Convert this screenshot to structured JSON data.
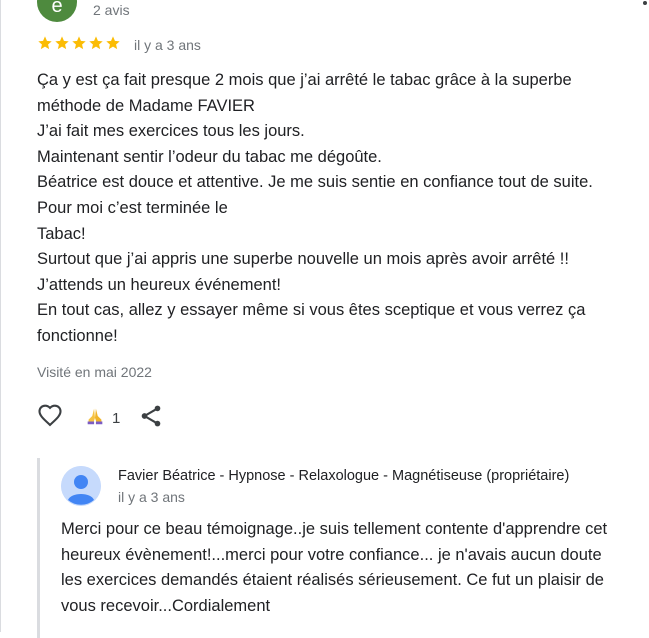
{
  "review": {
    "avatar_letter": "e",
    "avatar_color": "#4e8a3e",
    "review_count": "2 avis",
    "rating": 5,
    "star_color": "#fbbc04",
    "time_ago": "il y a 3 ans",
    "text_lines": [
      "Ça y est ça fait presque 2 mois que j’ai arrêté le tabac grâce à la superbe",
      "méthode de Madame FAVIER",
      "J’ai fait mes exercices tous les jours.",
      "Maintenant sentir l’odeur du tabac me dégoûte.",
      "Béatrice est douce et attentive. Je me suis sentie en confiance tout de suite.",
      "Pour moi c’est terminée le",
      "Tabac!",
      "Surtout que j’ai appris une superbe nouvelle un mois après avoir arrêté !!",
      "J’attends un heureux événement!",
      "En tout cas, allez y essayer même si vous êtes sceptique et vous verrez ça",
      "fonctionne!"
    ],
    "visited": "Visité en mai 2022",
    "reaction_count": "1",
    "like_icon": "heart-outline-icon",
    "reaction_icon": "praying-hands-icon",
    "share_icon": "share-icon"
  },
  "owner_reply": {
    "name": "Favier Béatrice - Hypnose - Relaxologue - Magnétiseuse (propriétaire)",
    "time_ago": "il y a 3 ans",
    "avatar_icon": "default-profile-icon",
    "text_lines": [
      "Merci pour ce beau témoignage..je suis tellement contente d'apprendre cet",
      "heureux évènement!...merci pour votre confiance... je n'avais aucun doute",
      "les exercices demandés étaient réalisés sérieusement. Ce fut un plaisir de",
      "vous recevoir...Cordialement"
    ]
  }
}
